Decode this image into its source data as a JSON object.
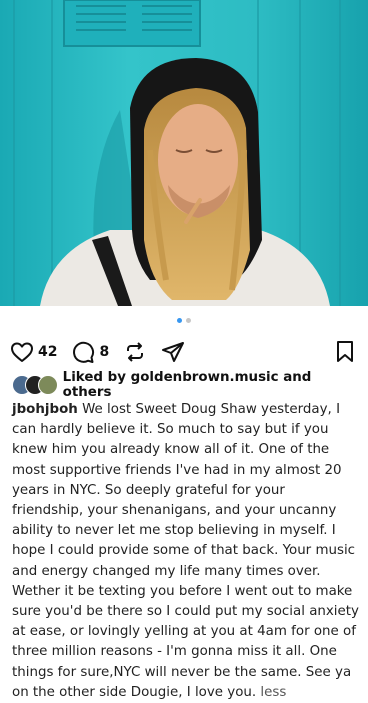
{
  "post": {
    "image_alt": "Man with long hair in a black hood against a teal wall",
    "carousel": {
      "dot_count": 2,
      "active_index": 0
    },
    "likes_count": "42",
    "comments_count": "8",
    "liked_by_text": "Liked by goldenbrown.music and others",
    "caption": {
      "username": "jbohjboh",
      "text": "We lost Sweet Doug Shaw yesterday, I can hardly believe it. So much to say but if you knew him you already know all of it. One of the most supportive friends I've had in my almost 20 years in NYC. So deeply grateful for your friendship, your shenanigans, and your uncanny ability to never let me stop believing in myself. I hope I could provide some of that back. Your music and energy changed my life many times over. Wether it be texting you before I went out to make sure you'd be there so I could put my social anxiety at ease, or lovingly yelling at you at 4am for one of three million reasons - I'm gonna miss it all. One things for sure,NYC will never be the same. See ya on the other side Dougie, I love you.",
      "more_label": "less"
    }
  },
  "icons": {
    "like": "heart-icon",
    "comment": "comment-bubble-icon",
    "repost": "repost-icon",
    "share": "send-icon",
    "save": "bookmark-icon"
  },
  "colors": {
    "active_dot": "#3897f0",
    "inactive_dot": "#c7c7c7",
    "wall_teal": "#2cbac2"
  }
}
